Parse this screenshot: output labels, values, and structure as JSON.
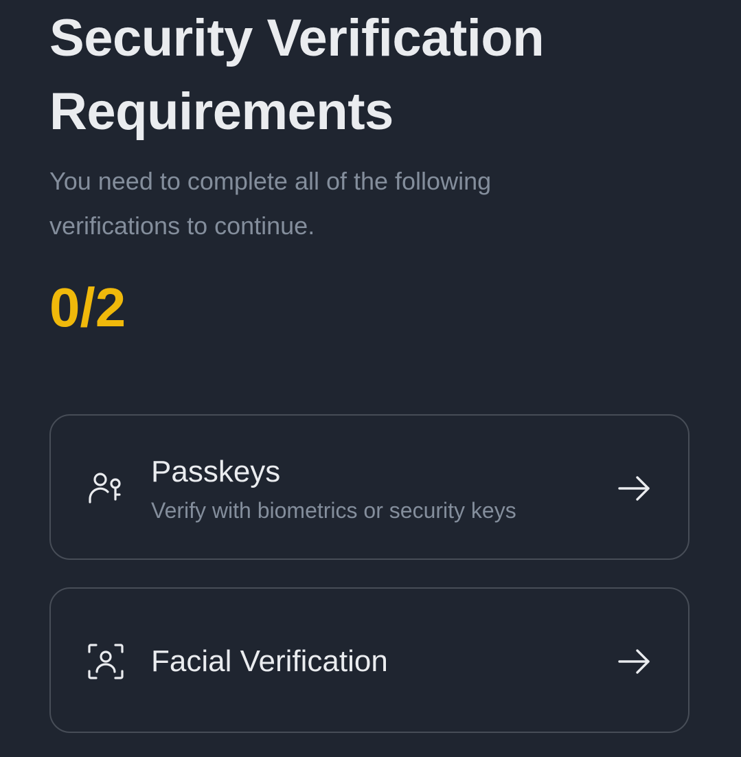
{
  "header": {
    "title": "Security Verification Requirements",
    "subtitle": "You need to complete all of the following verifications to continue.",
    "progress": "0/2"
  },
  "verifications": [
    {
      "label": "Passkeys",
      "description": "Verify with biometrics or security keys",
      "icon": "passkey-icon",
      "action_icon": "arrow-right-icon"
    },
    {
      "label": "Facial Verification",
      "icon": "face-scan-icon",
      "action_icon": "arrow-right-icon"
    }
  ],
  "colors": {
    "background": "#1f2530",
    "text_primary": "#eaecef",
    "text_secondary": "#848e9c",
    "accent": "#f0b90b",
    "card_border": "#474d57"
  }
}
